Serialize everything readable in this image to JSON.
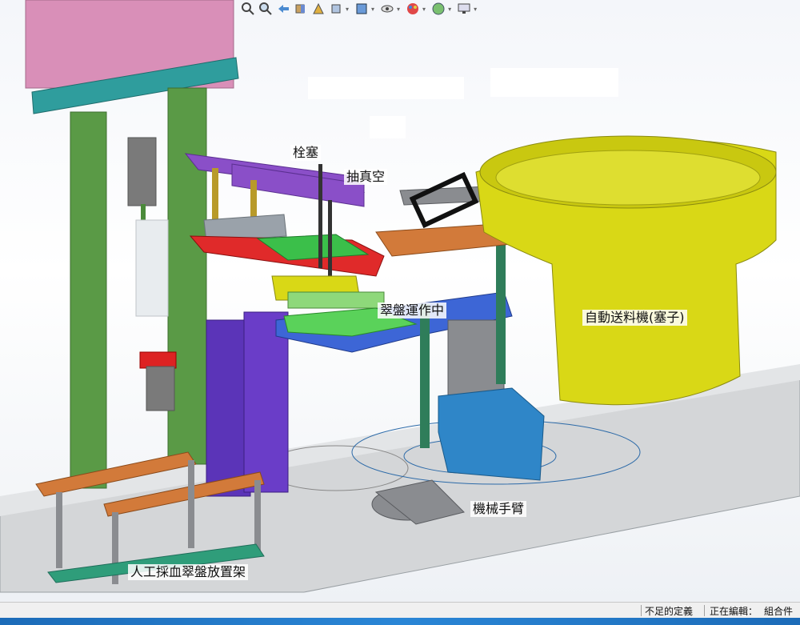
{
  "toolbar": {
    "icons": [
      "zoom-to-fit-icon",
      "zoom-to-area-icon",
      "previous-view-icon",
      "section-view-icon",
      "dynamic-annotation-icon",
      "view-orientation-icon",
      "display-style-icon",
      "hide-show-items-icon",
      "edit-appearance-icon",
      "apply-scene-icon",
      "view-settings-icon"
    ]
  },
  "annotations": {
    "plug": "栓塞",
    "vacuum": "抽真空",
    "tray_running": "翠盤運作中",
    "auto_feeder": "自動送料機(塞子)",
    "robot_arm": "機械手臂",
    "manual_rack": "人工採血翠盤放置架"
  },
  "status": {
    "under_defined": "不足的定義",
    "editing": "正在編輯：",
    "mode": "組合件"
  },
  "colors": {
    "feeder_yellow": "#d9d816",
    "column_green": "#5a9a46",
    "teal_plate": "#2f9d9d",
    "purple_bar": "#8a4fc8",
    "red_plate": "#e02a2a",
    "blue_plate": "#3d66d6",
    "robot_blue": "#2f86c8",
    "pink_block": "#d98fb8"
  }
}
